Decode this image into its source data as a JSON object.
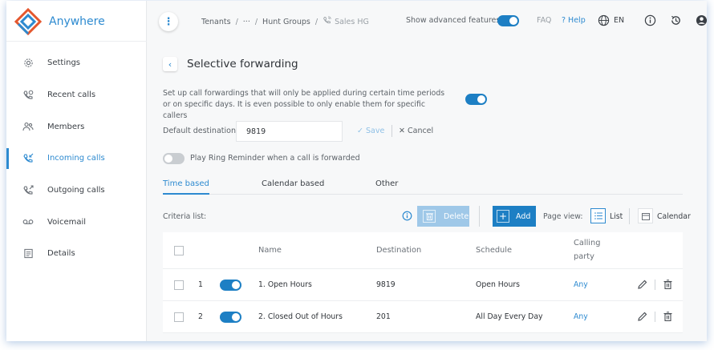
{
  "app": {
    "name": "Anywhere",
    "accent_color": "#2d8ad0",
    "toggle_color": "#1d7fc4"
  },
  "sidebar": {
    "items": [
      {
        "label": "Settings",
        "icon": "gear-icon"
      },
      {
        "label": "Recent calls",
        "icon": "phone-clock-icon"
      },
      {
        "label": "Members",
        "icon": "people-icon"
      },
      {
        "label": "Incoming calls",
        "icon": "phone-incoming-icon",
        "active": true
      },
      {
        "label": "Outgoing calls",
        "icon": "phone-outgoing-icon"
      },
      {
        "label": "Voicemail",
        "icon": "voicemail-icon"
      },
      {
        "label": "Details",
        "icon": "document-icon"
      }
    ]
  },
  "topbar": {
    "breadcrumb": [
      "Tenants",
      "···",
      "Hunt Groups",
      "Sales HG"
    ],
    "advanced_label": "Show advanced features",
    "advanced_on": true,
    "faq_label": "FAQ",
    "help_label": "? Help",
    "language": "EN"
  },
  "page": {
    "title": "Selective forwarding",
    "description": "Set up call forwardings that will only be applied during certain time periods or on specific days. It is even possible to only enable them for specific callers",
    "enabled": true,
    "default_destination_label": "Default destination:",
    "default_destination_value": "9819",
    "save_label": "Save",
    "cancel_label": "Cancel",
    "ring_reminder_label": "Play Ring Reminder when a call is forwarded",
    "ring_reminder_on": false
  },
  "tabs": [
    {
      "label": "Time based",
      "active": true
    },
    {
      "label": "Calendar based"
    },
    {
      "label": "Other"
    }
  ],
  "toolbar": {
    "criteria_label": "Criteria list:",
    "delete_label": "Delete",
    "add_label": "Add",
    "page_view_label": "Page view:",
    "list_label": "List",
    "calendar_label": "Calendar",
    "active_view": "List"
  },
  "table": {
    "headers": {
      "name": "Name",
      "destination": "Destination",
      "schedule": "Schedule",
      "calling_party_1": "Calling",
      "calling_party_2": "party"
    },
    "rows": [
      {
        "index": "1",
        "enabled": true,
        "name": "1. Open Hours",
        "destination": "9819",
        "schedule": "Open Hours",
        "calling_party": "Any"
      },
      {
        "index": "2",
        "enabled": true,
        "name": "2. Closed Out of Hours",
        "destination": "201",
        "schedule": "All Day Every Day",
        "calling_party": "Any"
      }
    ]
  }
}
